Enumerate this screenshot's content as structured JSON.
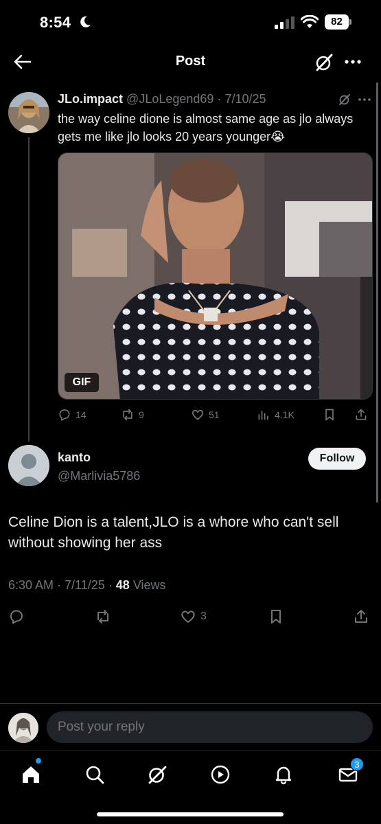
{
  "status_bar": {
    "time": "8:54",
    "battery": "82"
  },
  "header": {
    "title": "Post"
  },
  "parent_post": {
    "name": "JLo.impact",
    "handle": "@JLoLegend69",
    "date": "7/10/25",
    "text": "the way celine dione is almost same age as jlo always gets me like jlo  looks 20 years younger😭",
    "media_badge": "GIF",
    "replies": "14",
    "reposts": "9",
    "likes": "51",
    "views": "4.1K"
  },
  "reply_post": {
    "name": "kanto",
    "handle": "@Marlivia5786",
    "follow_label": "Follow",
    "text": "Celine Dion is a talent,JLO is a whore who can't sell without showing her ass",
    "time": "6:30 AM",
    "date": "7/11/25",
    "views_count": "48",
    "views_label": "Views",
    "likes": "3"
  },
  "composer": {
    "placeholder": "Post your reply"
  },
  "tabbar": {
    "messages_badge": "3"
  },
  "colors": {
    "accent": "#1d9bf0",
    "background": "#000000",
    "muted": "#71767b"
  }
}
